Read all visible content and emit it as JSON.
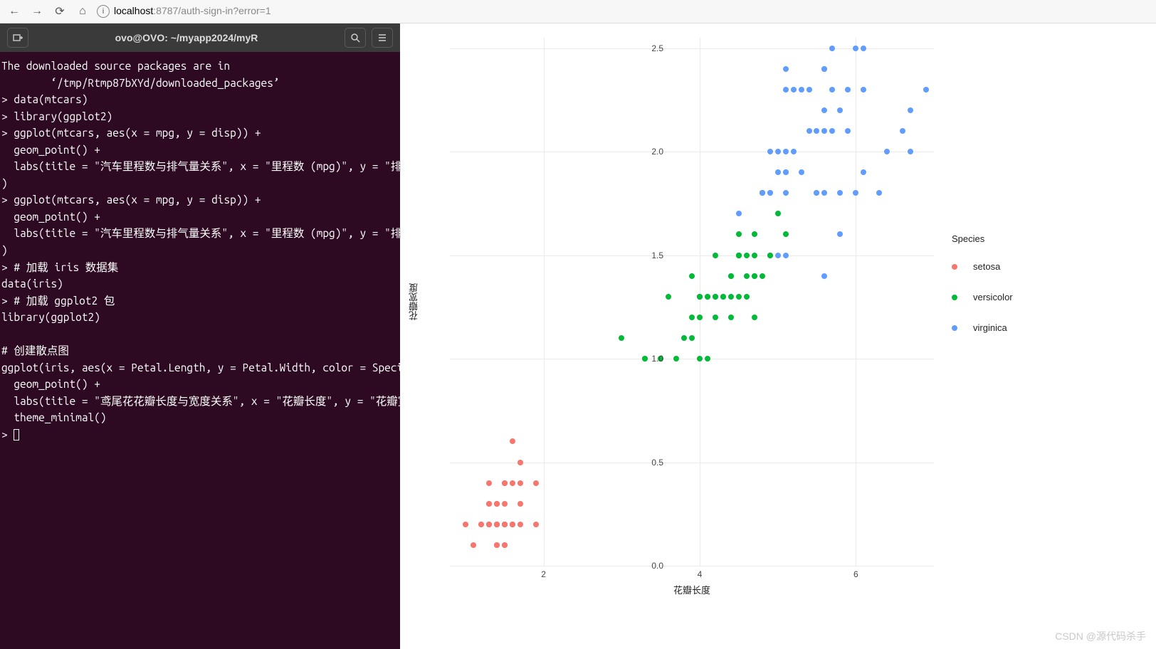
{
  "browser": {
    "url_host": "localhost",
    "url_path": ":8787/auth-sign-in?error=1"
  },
  "terminal": {
    "title": "ovo@OVO: ~/myapp2024/myR",
    "lines": [
      "The downloaded source packages are in",
      "        ‘/tmp/Rtmp87bXYd/downloaded_packages’",
      "> data(mtcars)",
      "> library(ggplot2)",
      "> ggplot(mtcars, aes(x = mpg, y = disp)) +",
      "  geom_point() +",
      "  labs(title = \"汽车里程数与排气量关系\", x = \"里程数 (mpg)\", y = \"排气",
      ")",
      "> ggplot(mtcars, aes(x = mpg, y = disp)) +",
      "  geom_point() +",
      "  labs(title = \"汽车里程数与排气量关系\", x = \"里程数 (mpg)\", y = \"排气",
      ")",
      "> # 加载 iris 数据集",
      "data(iris)",
      "> # 加载 ggplot2 包",
      "library(ggplot2)",
      "",
      "# 创建散点图",
      "ggplot(iris, aes(x = Petal.Length, y = Petal.Width, color = Species))",
      "  geom_point() +",
      "  labs(title = \"鸢尾花花瓣长度与宽度关系\", x = \"花瓣长度\", y = \"花瓣宽",
      "  theme_minimal()",
      "> "
    ]
  },
  "chart_data": {
    "type": "scatter",
    "xlabel": "花瓣长度",
    "ylabel": "花瓣宽度",
    "legend_title": "Species",
    "xlim": [
      0.8,
      7.0
    ],
    "ylim": [
      0.0,
      2.55
    ],
    "x_ticks": [
      2,
      4,
      6
    ],
    "y_ticks": [
      0.0,
      0.5,
      1.0,
      1.5,
      2.0,
      2.5
    ],
    "series": [
      {
        "name": "setosa",
        "color": "#f8766d",
        "x": [
          1.4,
          1.4,
          1.3,
          1.5,
          1.4,
          1.7,
          1.4,
          1.5,
          1.4,
          1.5,
          1.5,
          1.6,
          1.4,
          1.1,
          1.2,
          1.5,
          1.3,
          1.4,
          1.7,
          1.5,
          1.7,
          1.5,
          1.0,
          1.7,
          1.9,
          1.6,
          1.6,
          1.5,
          1.4,
          1.6,
          1.6,
          1.5,
          1.5,
          1.4,
          1.5,
          1.2,
          1.3,
          1.4,
          1.3,
          1.5,
          1.3,
          1.3,
          1.3,
          1.6,
          1.9,
          1.4,
          1.6,
          1.4,
          1.5,
          1.4
        ],
        "y": [
          0.2,
          0.2,
          0.2,
          0.2,
          0.2,
          0.4,
          0.3,
          0.2,
          0.2,
          0.1,
          0.2,
          0.2,
          0.1,
          0.1,
          0.2,
          0.4,
          0.4,
          0.3,
          0.3,
          0.3,
          0.2,
          0.4,
          0.2,
          0.5,
          0.2,
          0.2,
          0.4,
          0.2,
          0.2,
          0.2,
          0.2,
          0.4,
          0.1,
          0.2,
          0.2,
          0.2,
          0.2,
          0.1,
          0.2,
          0.2,
          0.3,
          0.3,
          0.2,
          0.6,
          0.4,
          0.3,
          0.2,
          0.2,
          0.2,
          0.2
        ]
      },
      {
        "name": "versicolor",
        "color": "#00ba38",
        "x": [
          4.7,
          4.5,
          4.9,
          4.0,
          4.6,
          4.5,
          4.7,
          3.3,
          4.6,
          3.9,
          3.5,
          4.2,
          4.0,
          4.7,
          3.6,
          4.4,
          4.5,
          4.1,
          4.5,
          3.9,
          4.8,
          4.0,
          4.9,
          4.7,
          4.3,
          4.4,
          4.8,
          5.0,
          4.5,
          3.5,
          3.8,
          3.7,
          3.9,
          5.1,
          4.5,
          4.5,
          4.7,
          4.4,
          4.1,
          4.0,
          4.4,
          4.6,
          4.0,
          3.3,
          4.2,
          4.2,
          4.2,
          4.3,
          3.0,
          4.1
        ],
        "y": [
          1.4,
          1.5,
          1.5,
          1.3,
          1.5,
          1.3,
          1.6,
          1.0,
          1.3,
          1.4,
          1.0,
          1.5,
          1.0,
          1.4,
          1.3,
          1.4,
          1.5,
          1.0,
          1.5,
          1.1,
          1.8,
          1.3,
          1.5,
          1.2,
          1.3,
          1.4,
          1.4,
          1.7,
          1.5,
          1.0,
          1.1,
          1.0,
          1.2,
          1.6,
          1.5,
          1.6,
          1.5,
          1.3,
          1.3,
          1.3,
          1.2,
          1.4,
          1.2,
          1.0,
          1.3,
          1.2,
          1.3,
          1.3,
          1.1,
          1.3
        ]
      },
      {
        "name": "virginica",
        "color": "#619cff",
        "x": [
          6.0,
          5.1,
          5.9,
          5.6,
          5.8,
          6.6,
          4.5,
          6.3,
          5.8,
          6.1,
          5.1,
          5.3,
          5.5,
          5.0,
          5.1,
          5.3,
          5.5,
          6.7,
          6.9,
          5.0,
          5.7,
          4.9,
          6.7,
          4.9,
          5.7,
          6.0,
          4.8,
          4.9,
          5.6,
          5.8,
          6.1,
          6.4,
          5.6,
          5.1,
          5.6,
          6.1,
          5.6,
          5.5,
          4.8,
          5.4,
          5.6,
          5.1,
          5.1,
          5.9,
          5.7,
          5.2,
          5.0,
          5.2,
          5.4,
          5.1
        ],
        "y": [
          2.5,
          1.9,
          2.1,
          1.8,
          2.2,
          2.1,
          1.7,
          1.8,
          1.8,
          2.5,
          2.0,
          1.9,
          2.1,
          2.0,
          2.4,
          2.3,
          1.8,
          2.2,
          2.3,
          1.5,
          2.3,
          2.0,
          2.0,
          1.8,
          2.1,
          1.8,
          1.8,
          1.8,
          2.1,
          1.6,
          1.9,
          2.0,
          2.2,
          1.5,
          1.4,
          2.3,
          2.4,
          1.8,
          1.8,
          2.1,
          2.4,
          2.3,
          1.9,
          2.3,
          2.5,
          2.3,
          1.9,
          2.0,
          2.3,
          1.8
        ]
      }
    ]
  },
  "watermark": "CSDN @源代码杀手"
}
